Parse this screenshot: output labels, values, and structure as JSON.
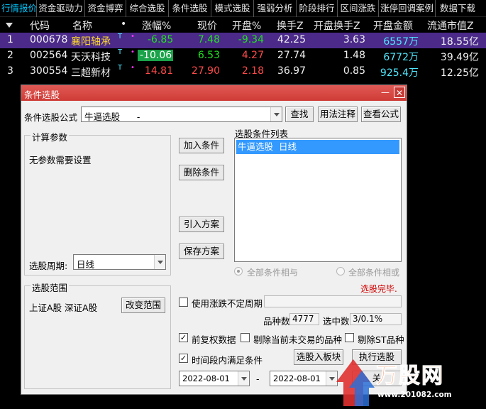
{
  "tabs": [
    "行情报价",
    "资金驱动力",
    "资金博弈",
    "综合选股",
    "条件选股",
    "模式选股",
    "强弱分析",
    "阶段排行",
    "区间涨跌",
    "涨停回调案例",
    "数据下载"
  ],
  "grid": {
    "sort_icon": "triangle-down-icon",
    "headers": [
      "代码",
      "名称",
      "•",
      "涨幅%",
      "现价",
      "开盘%",
      "换手Z",
      "开盘换手Z",
      "开盘金额",
      "流通市值Z"
    ],
    "rows": [
      {
        "idx": "1",
        "code": "000678",
        "name": "襄阳轴承",
        "tag": "T",
        "dot": "•",
        "change": "-6.85",
        "price": "7.48",
        "open_pct": "-9.34",
        "turnover": "42.25",
        "open_turnover": "3.63",
        "open_amount": "6557万",
        "mkt_cap": "18.55亿"
      },
      {
        "idx": "2",
        "code": "002564",
        "name": "天沃科技",
        "tag": "T",
        "dot": "•",
        "change": "-10.06",
        "price": "6.53",
        "open_pct": "4.27",
        "turnover": "27.74",
        "open_turnover": "1.48",
        "open_amount": "6772万",
        "mkt_cap": "39.49亿"
      },
      {
        "idx": "3",
        "code": "300554",
        "name": "三超新材",
        "tag": "T",
        "dot": "•",
        "change": "14.81",
        "price": "27.90",
        "open_pct": "2.18",
        "turnover": "36.97",
        "open_turnover": "0.85",
        "open_amount": "925.4万",
        "mkt_cap": "12.25亿"
      }
    ]
  },
  "dialog": {
    "title": "条件选股",
    "minimize": "—",
    "close": "✕",
    "formula_label": "条件选股公式",
    "formula_value": "牛逼选股      -",
    "btn_find": "查找",
    "btn_usage": "用法注释",
    "btn_view": "查看公式",
    "params_title": "计算参数",
    "params_text": "无参数需要设置",
    "btn_add": "加入条件",
    "btn_delete": "删除条件",
    "btn_import": "引入方案",
    "btn_save": "保存方案",
    "cond_list_title": "选股条件列表",
    "cond_item": "牛逼选股  日线",
    "period_label": "选股周期:",
    "period_value": "日线",
    "radio_and": "全部条件相与",
    "radio_or": "全部条件相或",
    "status": "选股完毕.",
    "range_title": "选股范围",
    "range_text": "上证A股 深证A股",
    "btn_change_range": "改变范围",
    "chk_uncertain": "使用涨跌不定周期",
    "count_label": "品种数",
    "count_value": "4777",
    "hit_label": "选中数",
    "hit_value": "3/0.1%",
    "chk_prefq": "前复权数据",
    "chk_exclude_notrade": "剔除当前未交易的品种",
    "chk_exclude_st": "剔除ST品种",
    "chk_period": "时间段内满足条件",
    "btn_to_block": "选股入板块",
    "btn_execute": "执行选股",
    "date_from": "2022-08-01",
    "date_sep": "-",
    "date_to": "2022-08-01",
    "btn_close": "关"
  },
  "watermark": {
    "brand": "万股网",
    "url": "www.201082.com"
  },
  "colors": {
    "active_tab": "#00c8ff",
    "selected_row": "#4b2a8a",
    "down": "#22e022",
    "up": "#ff4a4a",
    "titlebar": "#d9534f",
    "list_sel": "#3399ff"
  }
}
